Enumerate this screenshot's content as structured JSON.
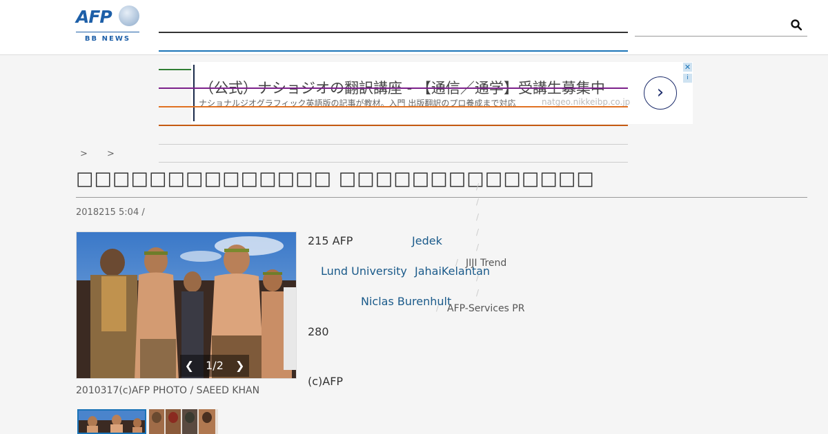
{
  "header": {
    "logo_text": "AFP",
    "logo_sub": "BB NEWS",
    "search_icon": "search-icon"
  },
  "colors": {
    "brand_blue": "#1d5fa8",
    "nav_rules": [
      "#333333",
      "#1a73b7",
      "#2e7d32",
      "#7b1f8a",
      "#e07020",
      "#c55a11"
    ]
  },
  "ad": {
    "title": "（公式）ナショジオの翻訳講座 - 【通信／通学】受講生募集中",
    "description": "ナショナルジオグラフィック英語版の記事が教材。入門 出版翻訳のプロ養成まで対応",
    "url": "natgeo.nikkeibp.co.jp",
    "arrow": "›",
    "close": "✕",
    "info": "i"
  },
  "breadcrumb": [
    ">",
    ">"
  ],
  "article": {
    "title": "□□□□□□□□□□□□□□ □□□□□□□□□□□□□□",
    "meta": "2018215 5:04  /",
    "photo_counter": "1/2",
    "photo_prev": "❮",
    "photo_next": "❯",
    "caption": "2010317(c)AFP PHOTO / SAEED KHAN",
    "para1_lead": "215 AFP",
    "link_jedek": "Jedek",
    "link_lund": "Lund University",
    "link_jahai": "JahaiKelantan",
    "link_niclas": "Niclas Burenhult",
    "number": "280",
    "credit": "(c)AFP"
  },
  "sidebar": {
    "jiji": "JIJI Trend",
    "afp_services": "AFP-Services PR"
  },
  "slashes": [
    "/",
    "/",
    "/",
    "/",
    "/",
    "/",
    "/",
    "/",
    "/"
  ]
}
